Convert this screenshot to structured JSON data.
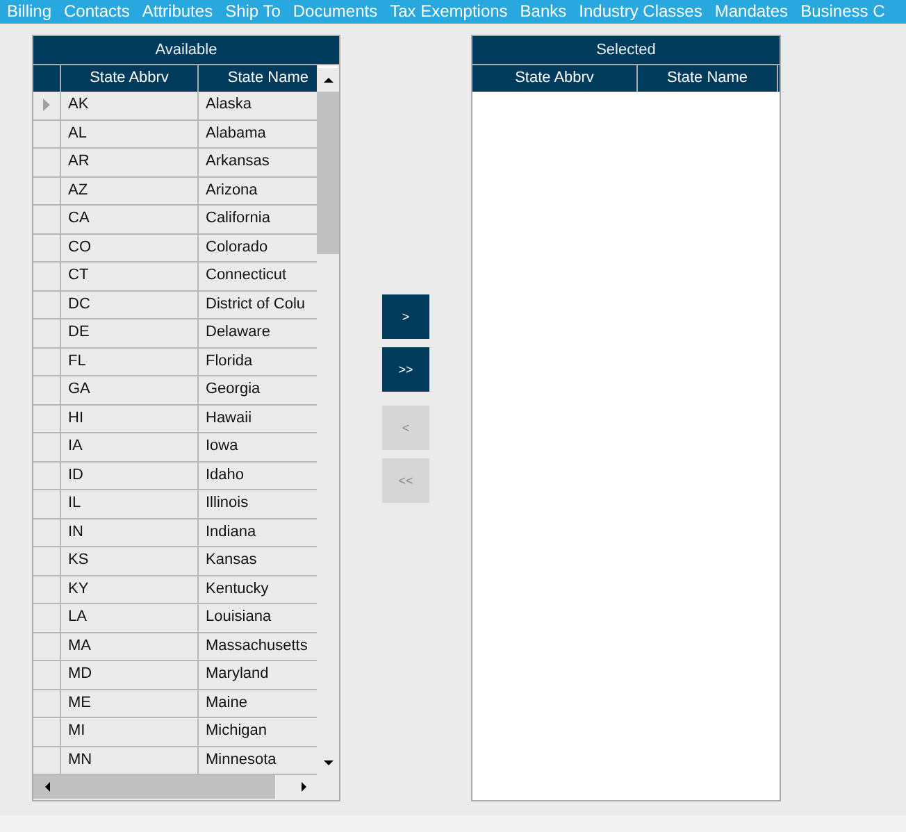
{
  "menu": [
    {
      "label": "Billing"
    },
    {
      "label": "Contacts"
    },
    {
      "label": "Attributes"
    },
    {
      "label": "Ship To"
    },
    {
      "label": "Documents"
    },
    {
      "label": "Tax Exemptions"
    },
    {
      "label": "Banks"
    },
    {
      "label": "Industry Classes"
    },
    {
      "label": "Mandates"
    },
    {
      "label": "Business C"
    }
  ],
  "available": {
    "title": "Available",
    "columns": [
      "State Abbrv",
      "State Name"
    ],
    "rows": [
      {
        "abbrv": "AK",
        "name": "Alaska",
        "current": true
      },
      {
        "abbrv": "AL",
        "name": "Alabama",
        "current": false
      },
      {
        "abbrv": "AR",
        "name": "Arkansas",
        "current": false
      },
      {
        "abbrv": "AZ",
        "name": "Arizona",
        "current": false
      },
      {
        "abbrv": "CA",
        "name": "California",
        "current": false
      },
      {
        "abbrv": "CO",
        "name": "Colorado",
        "current": false
      },
      {
        "abbrv": "CT",
        "name": "Connecticut",
        "current": false
      },
      {
        "abbrv": "DC",
        "name": "District of Colu",
        "current": false
      },
      {
        "abbrv": "DE",
        "name": "Delaware",
        "current": false
      },
      {
        "abbrv": "FL",
        "name": "Florida",
        "current": false
      },
      {
        "abbrv": "GA",
        "name": "Georgia",
        "current": false
      },
      {
        "abbrv": "HI",
        "name": "Hawaii",
        "current": false
      },
      {
        "abbrv": "IA",
        "name": "Iowa",
        "current": false
      },
      {
        "abbrv": "ID",
        "name": "Idaho",
        "current": false
      },
      {
        "abbrv": "IL",
        "name": "Illinois",
        "current": false
      },
      {
        "abbrv": "IN",
        "name": "Indiana",
        "current": false
      },
      {
        "abbrv": "KS",
        "name": "Kansas",
        "current": false
      },
      {
        "abbrv": "KY",
        "name": "Kentucky",
        "current": false
      },
      {
        "abbrv": "LA",
        "name": "Louisiana",
        "current": false
      },
      {
        "abbrv": "MA",
        "name": "Massachusetts",
        "current": false
      },
      {
        "abbrv": "MD",
        "name": "Maryland",
        "current": false
      },
      {
        "abbrv": "ME",
        "name": "Maine",
        "current": false
      },
      {
        "abbrv": "MI",
        "name": "Michigan",
        "current": false
      },
      {
        "abbrv": "MN",
        "name": "Minnesota",
        "current": false
      }
    ]
  },
  "buttons": [
    {
      "label": ">",
      "disabled": false
    },
    {
      "label": ">>",
      "disabled": false
    },
    {
      "label": "<",
      "disabled": true
    },
    {
      "label": "<<",
      "disabled": true
    }
  ],
  "selected": {
    "title": "Selected",
    "columns": [
      "State Abbrv",
      "State Name"
    ]
  }
}
